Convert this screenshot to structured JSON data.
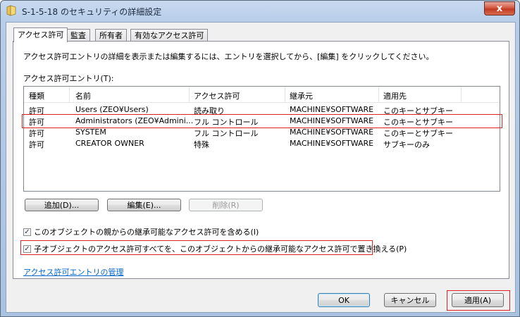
{
  "window": {
    "title": "S-1-5-18 のセキュリティの詳細設定",
    "close_symbol": "x"
  },
  "tabs": [
    {
      "label": "アクセス許可",
      "active": true
    },
    {
      "label": "監査",
      "active": false
    },
    {
      "label": "所有者",
      "active": false
    },
    {
      "label": "有効なアクセス許可",
      "active": false
    }
  ],
  "panel": {
    "description": "アクセス許可エントリの詳細を表示または編集するには、エントリを選択してから、[編集] をクリックしてください。",
    "list_label": "アクセス許可エントリ(T):",
    "columns": [
      "種類",
      "名前",
      "アクセス許可",
      "継承元",
      "適用先"
    ],
    "rows": [
      [
        "許可",
        "Users (ZEO¥Users)",
        "読み取り",
        "MACHINE¥SOFTWARE",
        "このキーとサブキー"
      ],
      [
        "許可",
        "Administrators (ZEO¥Admini...",
        "フル コントロール",
        "MACHINE¥SOFTWARE",
        "このキーとサブキー"
      ],
      [
        "許可",
        "SYSTEM",
        "フル コントロール",
        "MACHINE¥SOFTWARE",
        "このキーとサブキー"
      ],
      [
        "許可",
        "CREATOR OWNER",
        "特殊",
        "MACHINE¥SOFTWARE",
        "サブキーのみ"
      ]
    ],
    "buttons": {
      "add": "追加(D)...",
      "edit": "編集(E)...",
      "remove": "削除(R)"
    },
    "checkbox_inherit": {
      "label": "このオブジェクトの親からの継承可能なアクセス許可を含める(I)",
      "checked": true
    },
    "checkbox_replace": {
      "label": "子オブジェクトのアクセス許可すべてを、このオブジェクトからの継承可能なアクセス許可で置き換える(P)",
      "checked": true
    },
    "manage_link": "アクセス許可エントリの管理"
  },
  "footer": {
    "ok": "OK",
    "cancel": "キャンセル",
    "apply": "適用(A)"
  },
  "colors": {
    "highlight_border": "#e02020",
    "link": "#0066cc"
  }
}
